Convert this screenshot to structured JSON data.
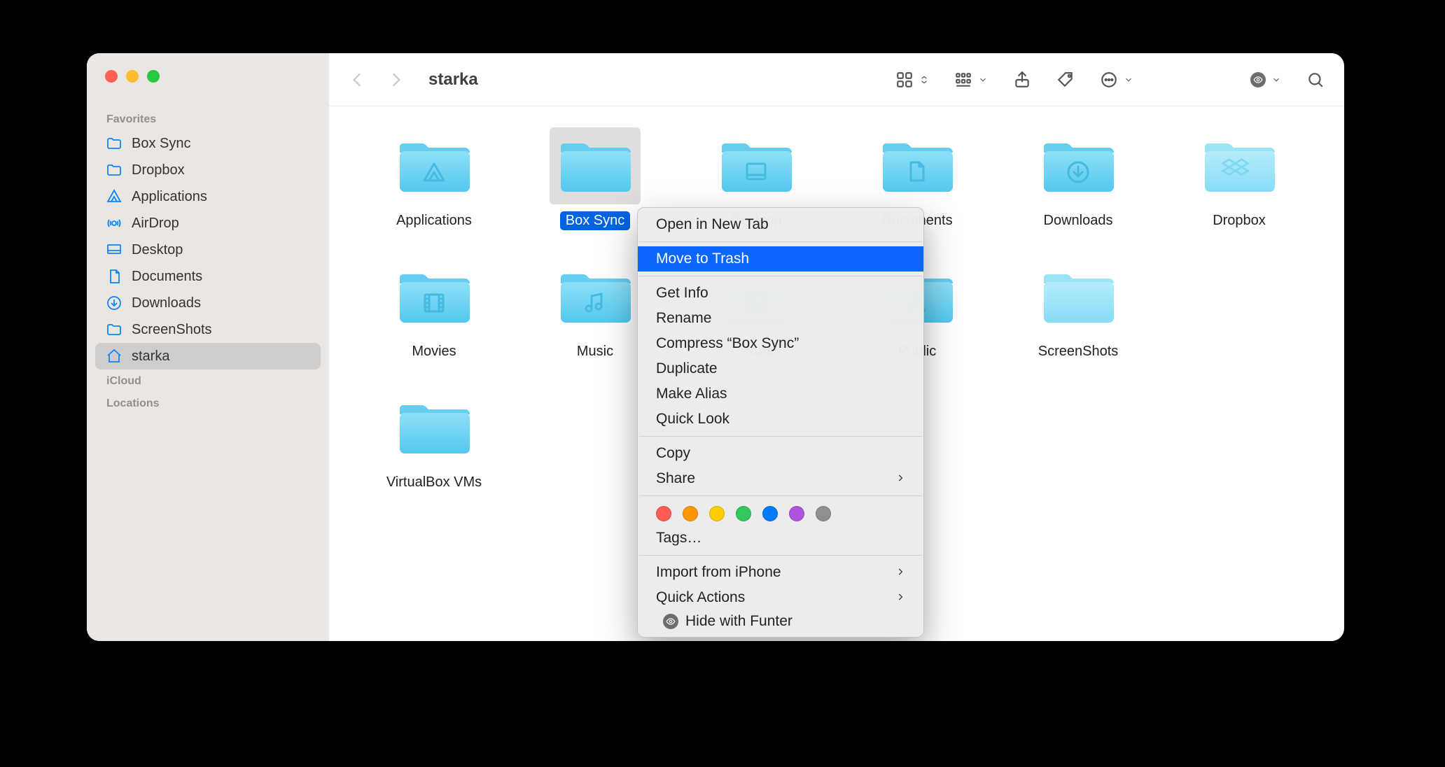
{
  "window": {
    "title": "starka"
  },
  "sidebar": {
    "sections": [
      {
        "header": "Favorites",
        "items": [
          {
            "icon": "folder-icon",
            "label": "Box Sync",
            "active": false
          },
          {
            "icon": "folder-icon",
            "label": "Dropbox",
            "active": false
          },
          {
            "icon": "applications-icon",
            "label": "Applications",
            "active": false
          },
          {
            "icon": "airdrop-icon",
            "label": "AirDrop",
            "active": false
          },
          {
            "icon": "desktop-icon",
            "label": "Desktop",
            "active": false
          },
          {
            "icon": "document-icon",
            "label": "Documents",
            "active": false
          },
          {
            "icon": "downloads-icon",
            "label": "Downloads",
            "active": false
          },
          {
            "icon": "folder-icon",
            "label": "ScreenShots",
            "active": false
          },
          {
            "icon": "home-icon",
            "label": "starka",
            "active": true
          }
        ]
      },
      {
        "header": "iCloud",
        "items": []
      },
      {
        "header": "Locations",
        "items": []
      }
    ]
  },
  "folders": [
    {
      "label": "Applications",
      "glyph": "applications",
      "selected": false
    },
    {
      "label": "Box Sync",
      "glyph": "plain",
      "selected": true
    },
    {
      "label": "Desktop",
      "glyph": "desktop",
      "selected": false
    },
    {
      "label": "Documents",
      "glyph": "document",
      "selected": false
    },
    {
      "label": "Downloads",
      "glyph": "download",
      "selected": false
    },
    {
      "label": "Dropbox",
      "glyph": "dropbox",
      "selected": false
    },
    {
      "label": "Movies",
      "glyph": "movie",
      "selected": false
    },
    {
      "label": "Music",
      "glyph": "music",
      "selected": false
    },
    {
      "label": "Pictures",
      "glyph": "picture",
      "selected": false
    },
    {
      "label": "Public",
      "glyph": "public",
      "selected": false
    },
    {
      "label": "ScreenShots",
      "glyph": "plain",
      "selected": false
    },
    {
      "label": "VirtualBox VMs",
      "glyph": "plain",
      "selected": false
    }
  ],
  "context_menu": {
    "groups": [
      [
        {
          "label": "Open in New Tab"
        }
      ],
      [
        {
          "label": "Move to Trash",
          "highlight": true
        }
      ],
      [
        {
          "label": "Get Info"
        },
        {
          "label": "Rename"
        },
        {
          "label": "Compress “Box Sync”"
        },
        {
          "label": "Duplicate"
        },
        {
          "label": "Make Alias"
        },
        {
          "label": "Quick Look"
        }
      ],
      [
        {
          "label": "Copy"
        },
        {
          "label": "Share",
          "submenu": true
        }
      ]
    ],
    "tag_colors": [
      "#ff5b52",
      "#ff9500",
      "#ffcc00",
      "#34c759",
      "#007aff",
      "#af52de",
      "#8e8e93"
    ],
    "tags_label": "Tags…",
    "footer": [
      {
        "label": "Import from iPhone",
        "submenu": true
      },
      {
        "label": "Quick Actions",
        "submenu": true
      }
    ],
    "funter": "Hide with Funter"
  },
  "colors": {
    "folder_light": "#8fe0f7",
    "folder_dark": "#52c8ee",
    "folder_tab": "#65cdf0"
  }
}
